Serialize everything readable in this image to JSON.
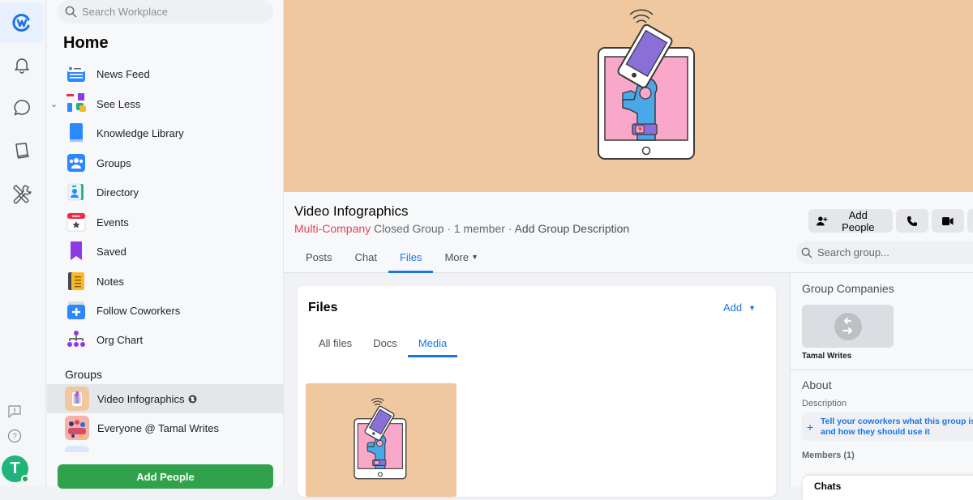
{
  "rail": {
    "items": [
      {
        "name": "workplace-logo",
        "active": true
      },
      {
        "name": "notifications"
      },
      {
        "name": "chat"
      },
      {
        "name": "knowledge-library"
      },
      {
        "name": "admin-tools"
      }
    ],
    "bottom": [
      "feedback",
      "help"
    ],
    "avatar_initial": "T"
  },
  "sidebar": {
    "search_placeholder": "Search Workplace",
    "home_title": "Home",
    "items": [
      {
        "label": "News Feed",
        "icon": "news-feed-icon"
      },
      {
        "label": "See Less",
        "icon": "apps-icon"
      },
      {
        "label": "Knowledge Library",
        "icon": "book-icon"
      },
      {
        "label": "Groups",
        "icon": "groups-icon"
      },
      {
        "label": "Directory",
        "icon": "directory-icon"
      },
      {
        "label": "Events",
        "icon": "calendar-icon"
      },
      {
        "label": "Saved",
        "icon": "bookmark-icon"
      },
      {
        "label": "Notes",
        "icon": "notes-icon"
      },
      {
        "label": "Follow Coworkers",
        "icon": "follow-icon"
      },
      {
        "label": "Org Chart",
        "icon": "org-chart-icon"
      }
    ],
    "groups_heading": "Groups",
    "groups": [
      {
        "label": "Video Infographics",
        "active": true
      },
      {
        "label": "Everyone @ Tamal Writes"
      }
    ],
    "add_people_label": "Add People"
  },
  "group": {
    "title": "Video Infographics",
    "company_type": "Multi-Company",
    "privacy": "Closed Group",
    "members_count": "1 member",
    "separator": "·",
    "add_description": "Add Group Description",
    "tabs": [
      {
        "label": "Posts"
      },
      {
        "label": "Chat"
      },
      {
        "label": "Files",
        "active": true
      },
      {
        "label": "More"
      }
    ],
    "actions": {
      "add_people": "Add People"
    },
    "search_placeholder": "Search group..."
  },
  "files": {
    "title": "Files",
    "add_label": "Add",
    "tabs": [
      {
        "label": "All files"
      },
      {
        "label": "Docs"
      },
      {
        "label": "Media",
        "active": true
      }
    ]
  },
  "right": {
    "group_companies_heading": "Group Companies",
    "company_name": "Tamal Writes",
    "about_heading": "About",
    "description_label": "Description",
    "description_prompt_1": "Tell your coworkers what this group is",
    "description_prompt_2": "and how they should use it",
    "members_label": "Members (1)",
    "chats_label": "Chats"
  },
  "colors": {
    "accent": "#1b74e4",
    "cover": "#efc8a0",
    "green": "#31a24c",
    "multi_company": "#e0455b"
  }
}
